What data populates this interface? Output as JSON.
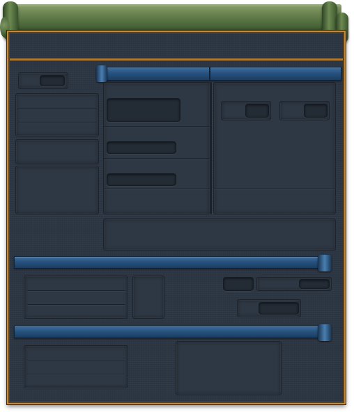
{
  "window": {
    "title": ""
  },
  "colors": {
    "banner_green": "#6a8350",
    "frame_gold": "#c48a3a",
    "panel_slate": "#2c3643",
    "ribbon_blue": "#27527f"
  },
  "icons": {
    "banner": "scroll-banner-icon",
    "ribbon_end": "ribbon-end-icon"
  }
}
